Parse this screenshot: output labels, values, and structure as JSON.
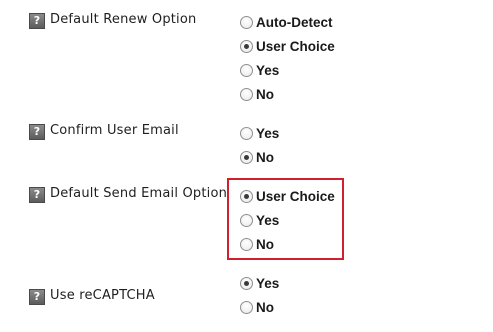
{
  "help_glyph": "?",
  "highlight_color": "#d0202e",
  "settings": [
    {
      "label": "Default Renew Option",
      "options": [
        {
          "label": "Auto-Detect",
          "checked": false
        },
        {
          "label": "User Choice",
          "checked": true
        },
        {
          "label": "Yes",
          "checked": false
        },
        {
          "label": "No",
          "checked": false
        }
      ]
    },
    {
      "label": "Confirm User Email",
      "options": [
        {
          "label": "Yes",
          "checked": false
        },
        {
          "label": "No",
          "checked": true
        }
      ]
    },
    {
      "label": "Default Send Email Option",
      "options": [
        {
          "label": "User Choice",
          "checked": true
        },
        {
          "label": "Yes",
          "checked": false
        },
        {
          "label": "No",
          "checked": false
        }
      ]
    },
    {
      "label": "Use reCAPTCHA",
      "options": [
        {
          "label": "Yes",
          "checked": true
        },
        {
          "label": "No",
          "checked": false
        }
      ]
    }
  ]
}
